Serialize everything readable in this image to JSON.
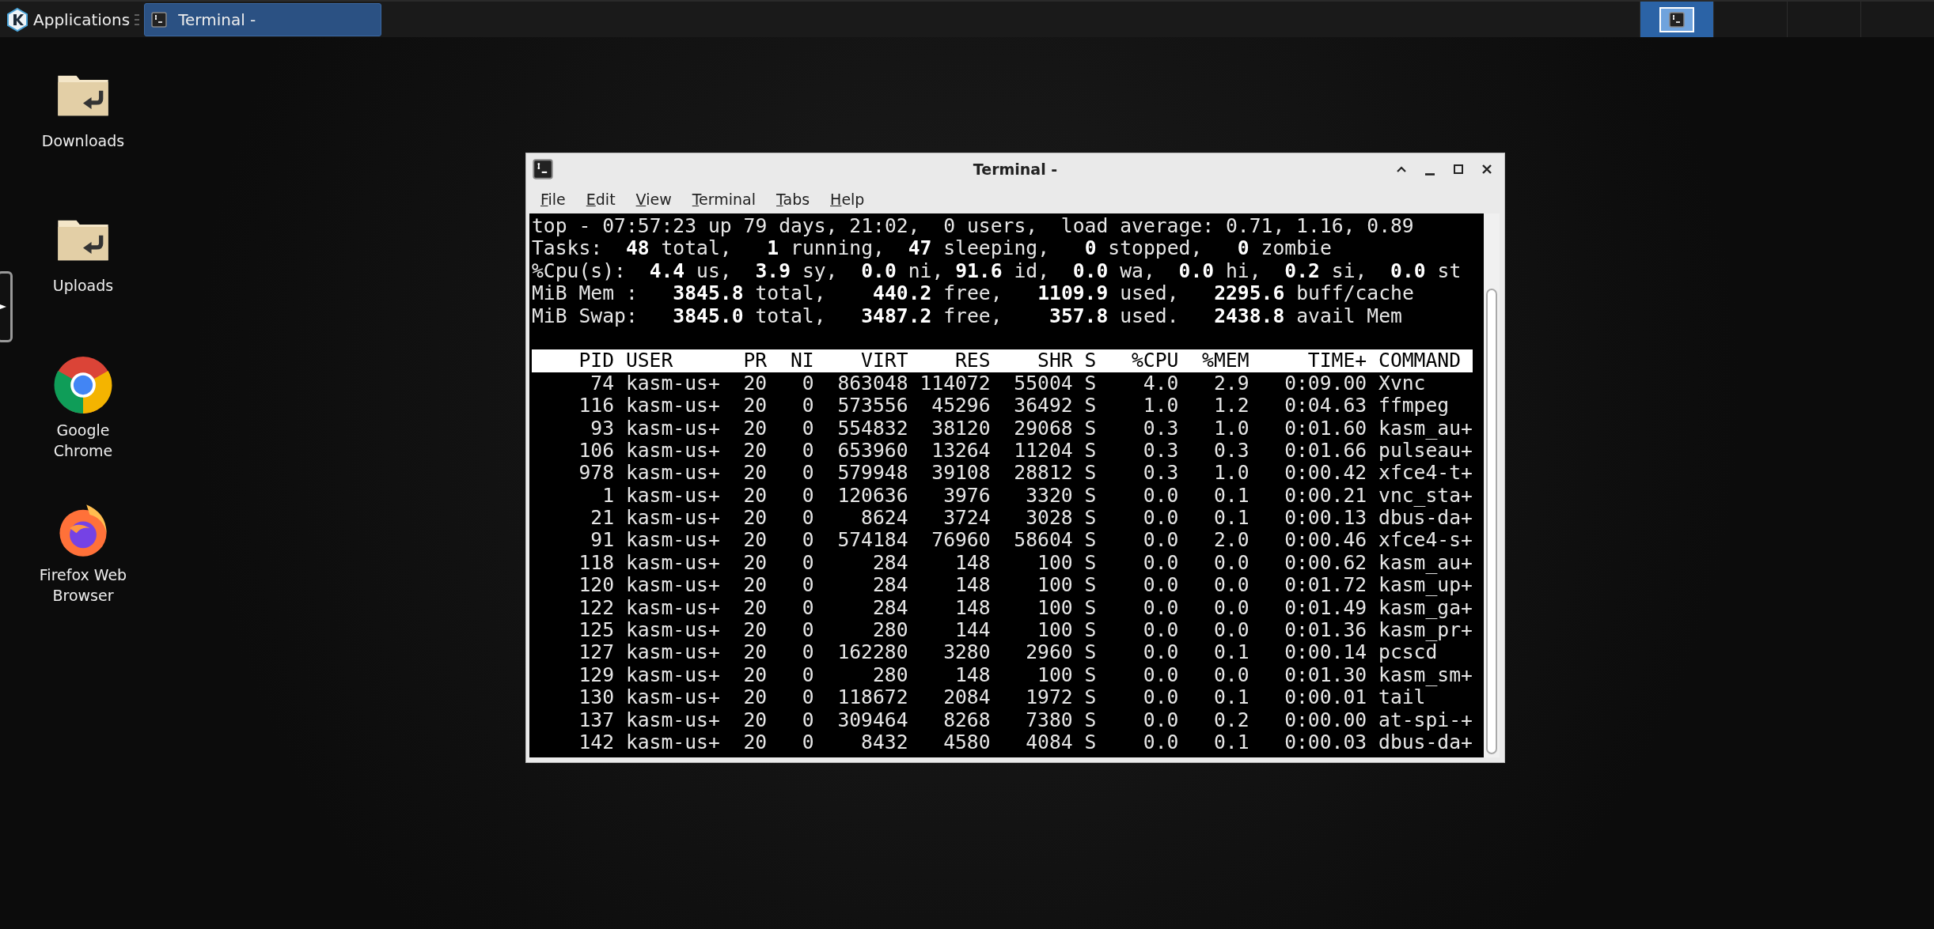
{
  "taskbar": {
    "menu_label": "Applications",
    "windows": [
      {
        "title": "Terminal -",
        "selected": true
      }
    ],
    "workspaces": [
      {
        "selected": true,
        "has_window": true
      },
      {
        "selected": false,
        "has_window": false
      },
      {
        "selected": false,
        "has_window": false
      },
      {
        "selected": false,
        "has_window": false
      }
    ]
  },
  "desktop_icons": [
    {
      "label": "Downloads",
      "kind": "folder"
    },
    {
      "label": "Uploads",
      "kind": "folder"
    },
    {
      "label": "Google Chrome",
      "kind": "chrome"
    },
    {
      "label": "Firefox Web Browser",
      "kind": "firefox"
    }
  ],
  "window": {
    "title": "Terminal -",
    "menu": [
      "File",
      "Edit",
      "View",
      "Terminal",
      "Tabs",
      "Help"
    ],
    "summary_lines": [
      "top - 07:57:23 up 79 days, 21:02,  0 users,  load average: 0.71, 1.16, 0.89",
      "Tasks:  **48** total,   **1** running,  **47** sleeping,   **0** stopped,   **0** zombie",
      "%Cpu(s):  **4.4** us,  **3.9** sy,  **0.0** ni, **91.6** id,  **0.0** wa,  **0.0** hi,  **0.2** si,  **0.0** st",
      "MiB Mem :   **3845.8** total,    **440.2** free,   **1109.9** used,   **2295.6** buff/cache",
      "MiB Swap:   **3845.0** total,   **3487.2** free,    **357.8** used.   **2438.8** avail Mem"
    ],
    "table": {
      "columns": [
        "PID",
        "USER",
        "PR",
        "NI",
        "VIRT",
        "RES",
        "SHR",
        "S",
        "%CPU",
        "%MEM",
        "TIME+",
        "COMMAND"
      ],
      "rows": [
        [
          "74",
          "kasm-us+",
          "20",
          "0",
          "863048",
          "114072",
          "55004",
          "S",
          "4.0",
          "2.9",
          "0:09.00",
          "Xvnc"
        ],
        [
          "116",
          "kasm-us+",
          "20",
          "0",
          "573556",
          "45296",
          "36492",
          "S",
          "1.0",
          "1.2",
          "0:04.63",
          "ffmpeg"
        ],
        [
          "93",
          "kasm-us+",
          "20",
          "0",
          "554832",
          "38120",
          "29068",
          "S",
          "0.3",
          "1.0",
          "0:01.60",
          "kasm_au+"
        ],
        [
          "106",
          "kasm-us+",
          "20",
          "0",
          "653960",
          "13264",
          "11204",
          "S",
          "0.3",
          "0.3",
          "0:01.66",
          "pulseau+"
        ],
        [
          "978",
          "kasm-us+",
          "20",
          "0",
          "579948",
          "39108",
          "28812",
          "S",
          "0.3",
          "1.0",
          "0:00.42",
          "xfce4-t+"
        ],
        [
          "1",
          "kasm-us+",
          "20",
          "0",
          "120636",
          "3976",
          "3320",
          "S",
          "0.0",
          "0.1",
          "0:00.21",
          "vnc_sta+"
        ],
        [
          "21",
          "kasm-us+",
          "20",
          "0",
          "8624",
          "3724",
          "3028",
          "S",
          "0.0",
          "0.1",
          "0:00.13",
          "dbus-da+"
        ],
        [
          "91",
          "kasm-us+",
          "20",
          "0",
          "574184",
          "76960",
          "58604",
          "S",
          "0.0",
          "2.0",
          "0:00.46",
          "xfce4-s+"
        ],
        [
          "118",
          "kasm-us+",
          "20",
          "0",
          "284",
          "148",
          "100",
          "S",
          "0.0",
          "0.0",
          "0:00.62",
          "kasm_au+"
        ],
        [
          "120",
          "kasm-us+",
          "20",
          "0",
          "284",
          "148",
          "100",
          "S",
          "0.0",
          "0.0",
          "0:01.72",
          "kasm_up+"
        ],
        [
          "122",
          "kasm-us+",
          "20",
          "0",
          "284",
          "148",
          "100",
          "S",
          "0.0",
          "0.0",
          "0:01.49",
          "kasm_ga+"
        ],
        [
          "125",
          "kasm-us+",
          "20",
          "0",
          "280",
          "144",
          "100",
          "S",
          "0.0",
          "0.0",
          "0:01.36",
          "kasm_pr+"
        ],
        [
          "127",
          "kasm-us+",
          "20",
          "0",
          "162280",
          "3280",
          "2960",
          "S",
          "0.0",
          "0.1",
          "0:00.14",
          "pcscd"
        ],
        [
          "129",
          "kasm-us+",
          "20",
          "0",
          "280",
          "148",
          "100",
          "S",
          "0.0",
          "0.0",
          "0:01.30",
          "kasm_sm+"
        ],
        [
          "130",
          "kasm-us+",
          "20",
          "0",
          "118672",
          "2084",
          "1972",
          "S",
          "0.0",
          "0.1",
          "0:00.01",
          "tail"
        ],
        [
          "137",
          "kasm-us+",
          "20",
          "0",
          "309464",
          "8268",
          "7380",
          "S",
          "0.0",
          "0.2",
          "0:00.00",
          "at-spi-+"
        ],
        [
          "142",
          "kasm-us+",
          "20",
          "0",
          "8432",
          "4580",
          "4084",
          "S",
          "0.0",
          "0.1",
          "0:00.03",
          "dbus-da+"
        ]
      ]
    }
  }
}
